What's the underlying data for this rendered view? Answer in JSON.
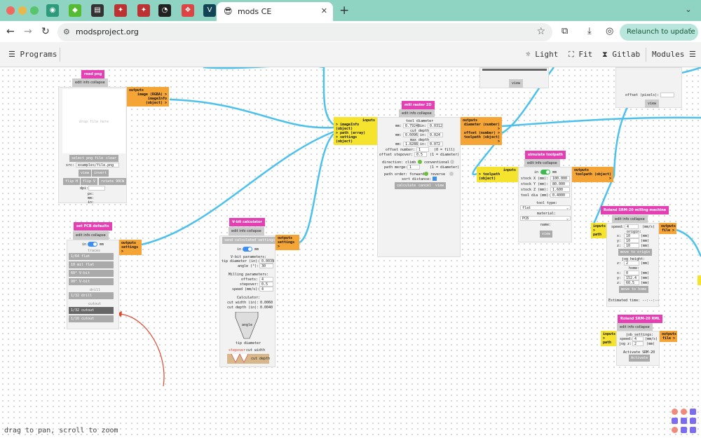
{
  "browser": {
    "active_tab": {
      "title": "mods CE",
      "favicon": "😎"
    },
    "address": "modsproject.org",
    "relaunch_label": "Relaunch to update"
  },
  "menubar": {
    "programs": "Programs",
    "light": "Light",
    "fit": "Fit",
    "gitlab": "Gitlab",
    "modules": "Modules"
  },
  "modules": {
    "read_png": {
      "title": "read png",
      "edit": "edit info collapse",
      "outputs_label": "outputs",
      "outputs": [
        "image (RGBA) >",
        "imageInfo (object) >"
      ],
      "drop": "drop file here",
      "select": "select png file",
      "clear": "clear",
      "src_label": "src:",
      "src_value": "examples/file.png",
      "view": "view",
      "invert": "invert",
      "flip_h": "flip H",
      "flip_v": "flip V",
      "rotate": "rotate 90CW",
      "dpi": "dpi:",
      "px": "px:",
      "mm": "mm:",
      "in": "in:"
    },
    "set_pcb": {
      "title": "set PCB defaults",
      "edit": "edit info collapse",
      "outputs_label": "outputs",
      "output": "settings >",
      "in": "in",
      "mm": "mm",
      "traces": "traces",
      "drill": "drill",
      "cutout": "cutout",
      "trace_rows": [
        "1/64 flat",
        "10 mil flat",
        "60° V-bit",
        "90° V-bit"
      ],
      "drill_rows": [
        "1/32 drill"
      ],
      "cutout_rows": [
        "1/32 cutout",
        "1/16 cutout"
      ]
    },
    "vbit": {
      "title": "V-bit calculator",
      "edit": "edit info collapse",
      "send": "send calculated settings",
      "outputs_label": "outputs",
      "output": "settings >",
      "in": "in",
      "mm": "mm",
      "vbit_params": "V-bit parameters:",
      "tip_label": "tip diameter (in):",
      "tip": "0.0039",
      "angle_label": "angle (°):",
      "angle": "30",
      "mill_params": "Milling parameters:",
      "offsets_label": "offsets:",
      "offsets": "4",
      "stepover_label": "stepover:",
      "stepover": "0.5",
      "speed_label": "speed (mm/s):",
      "speed": "4",
      "calc": "Calculator:",
      "cut_width_label": "cut width (in):",
      "cut_width": "0.0060",
      "cut_depth_label": "cut depth (in):",
      "cut_depth": "0.0040",
      "angle_tag": "angle",
      "tip_tag": "tip diameter",
      "stepover_tag": "stepover",
      "cutwidth_tag": "cut width",
      "cutdepth_tag": "cut depth"
    },
    "mill": {
      "title": "mill raster 2D",
      "edit": "edit info collapse",
      "inputs_label": "inputs",
      "inputs": [
        "> imageInfo (object)",
        "> path (array)",
        "> settings (object)"
      ],
      "outputs_label": "outputs",
      "outputs": [
        "diameter (number) >",
        "offset (number) >",
        "toolpath (object) >"
      ],
      "tool_diameter": "tool diameter",
      "td_mm": "0.79248",
      "td_in": "0.0312",
      "cut_depth": "cut depth",
      "cd_mm": "0.6096",
      "cd_in": "0.024",
      "max_depth": "max depth",
      "md_mm": "1.8288",
      "md_in": "0.072",
      "offset_number_label": "offset number:",
      "offset_number": "1",
      "offset_number_note": "(0 = fill)",
      "offset_stepover_label": "offset stepover:",
      "offset_stepover": "0.5",
      "offset_stepover_note": "(1 = diameter)",
      "direction": "direction: climb",
      "conventional": "conventional",
      "merge": "path merge:",
      "merge_val": "1",
      "merge_note": "(1 = diameter)",
      "order": "path order: forward",
      "reverse": "reverse",
      "sort": "sort distance:",
      "calculate": "calculate",
      "cancel": "cancel",
      "view": "view",
      "mm": "mm:",
      "in": "in:"
    },
    "simulate": {
      "title": "simulate toolpath",
      "edit": "edit info collapse",
      "inputs_label": "inputs",
      "input": "> toolpath (object)",
      "outputs_label": "outputs",
      "output": "toolpath (object) >",
      "in": "in",
      "mm": "mm",
      "stock_x_label": "stock X (mm):",
      "stock_x": "100.000",
      "stock_y_label": "stock Y (mm):",
      "stock_y": "80.000",
      "stock_z_label": "stock Z (mm):",
      "stock_z": "1.600",
      "tool_dia_label": "tool dia (mm):",
      "tool_dia": "0.4000",
      "tool_type": "tool type:",
      "tool_type_val": "flat",
      "material": "material:",
      "material_val": "PCB",
      "name": "name:",
      "view": "view"
    },
    "roland": {
      "title": "Roland SRM-20 milling machine",
      "edit": "edit info collapse",
      "inputs_label": "inputs",
      "input": "> path",
      "outputs_label": "outputs",
      "output": "file >",
      "speed_label": "speed:",
      "speed": "4",
      "speed_unit": "(mm/s)",
      "origin": "origin:",
      "ox_label": "x:",
      "ox": "10",
      "oy_label": "y:",
      "oy": "10",
      "oz_label": "z:",
      "oz": "10",
      "move_origin": "move to origin",
      "jog": "jog height:",
      "jog_z_label": "z:",
      "jog_z": "2",
      "home": "home:",
      "hx_label": "x:",
      "hx": "0",
      "hy_label": "y:",
      "hy": "152.4",
      "hz_label": "z:",
      "hz": "60.5",
      "move_home": "move to home",
      "unit": "(mm)",
      "estimated": "Estimated time: --:--:--"
    },
    "roland_rml": {
      "title": "Roland SRM-20 RML",
      "edit": "edit info collapse",
      "inputs_label": "inputs",
      "input": "> path",
      "outputs_label": "outputs",
      "output": "file >",
      "job": "job settings:",
      "speed_label": "speed:",
      "speed": "4",
      "speed_unit": "(mm/s)",
      "jogz_label": "jog z:",
      "jogz": "2",
      "jogz_unit": "(mm)",
      "activate_label": "Activate SRM-20",
      "activate": "Activate"
    },
    "partial_top": {
      "view": "view"
    },
    "partial_right": {
      "offset_label": "offset (pixels):",
      "view": "view"
    }
  },
  "status": {
    "hint": "drag to pan, scroll to zoom"
  },
  "colors": {
    "title": "#e63fb3",
    "outputs": "#f5a436",
    "inputs": "#f6e32d",
    "wire": "#4cc1ec",
    "annotation": "#e0452a"
  }
}
